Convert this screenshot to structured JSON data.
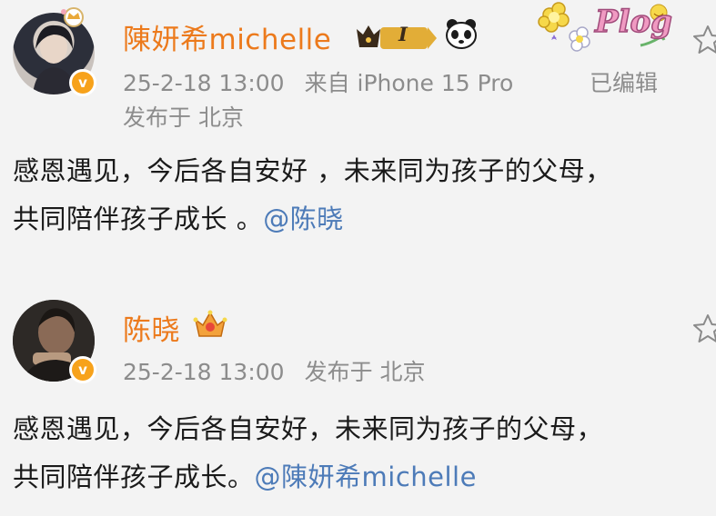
{
  "posts": [
    {
      "author": "陳妍希michelle",
      "timestamp": "25-2-18 13:00",
      "source": "来自 iPhone 15 Pro",
      "edited": "已编辑",
      "location": "发布于 北京",
      "badge_level": "I",
      "sticker_text": "Plog",
      "text_line1": "感恩遇见，今后各自安好 ，未来同为孩子的父母，",
      "text_line2": "共同陪伴孩子成长 。",
      "mention": "@陈晓"
    },
    {
      "author": "陈晓",
      "timestamp": "25-2-18 13:00",
      "location": "发布于 北京",
      "text_line1": "感恩遇见，今后各自安好，未来同为孩子的父母，",
      "text_line2": "共同陪伴孩子成长。",
      "mention": "@陳妍希michelle"
    }
  ],
  "colors": {
    "background": "#f3f3f3",
    "author_name": "#ec7a1c",
    "meta": "#8c8c8c",
    "mention": "#4d7bb8",
    "verified_badge": "#f7a21b"
  }
}
